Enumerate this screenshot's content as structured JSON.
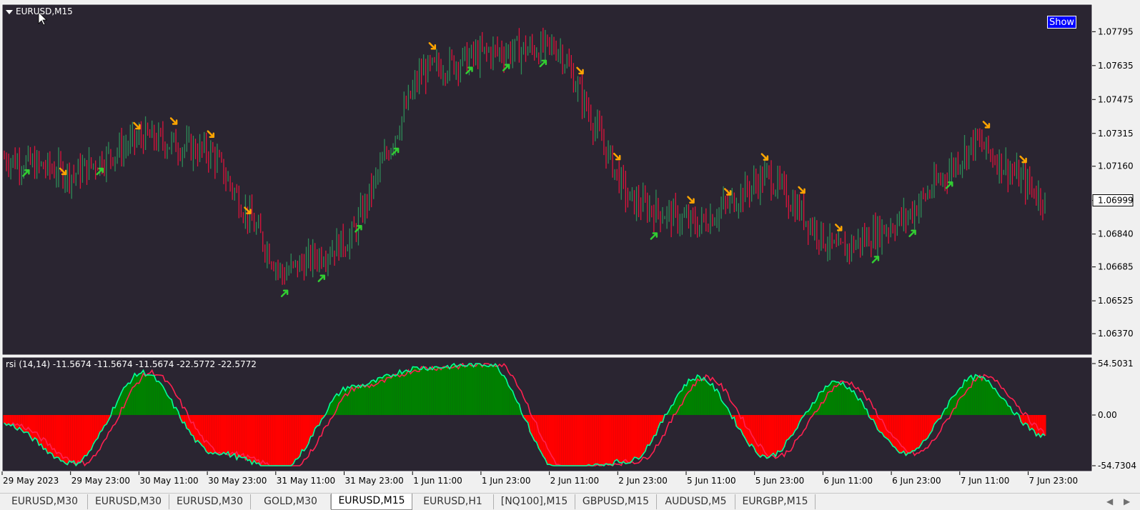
{
  "window": {
    "symbol_title": "EURUSD,M15",
    "show_button": "Show"
  },
  "colors": {
    "background": "#2a2531",
    "bull": "#2e8b57",
    "bear": "#dc143c",
    "buy_arrow": "#32cd32",
    "sell_arrow": "#ffa500",
    "rsi_pos": "#008000",
    "rsi_neg": "#ff0000",
    "rsi_fast": "#00ff99",
    "rsi_slow": "#ff2050"
  },
  "price_axis": {
    "labels": [
      "1.07795",
      "1.07635",
      "1.07475",
      "1.07315",
      "1.07160",
      "1.06999",
      "1.06840",
      "1.06685",
      "1.06525",
      "1.06370"
    ],
    "current_price": "1.06999"
  },
  "rsi_panel": {
    "label": "rsi  (14,14) -11.5674 -11.5674 -11.5674 -22.5772 -22.5772",
    "axis_labels": [
      "54.5031",
      "0.00",
      "-54.7304"
    ]
  },
  "time_axis": {
    "labels": [
      "29 May 2023",
      "29 May 23:00",
      "30 May 11:00",
      "30 May 23:00",
      "31 May 11:00",
      "31 May 23:00",
      "1 Jun 11:00",
      "1 Jun 23:00",
      "2 Jun 11:00",
      "2 Jun 23:00",
      "5 Jun 11:00",
      "5 Jun 23:00",
      "6 Jun 11:00",
      "6 Jun 23:00",
      "7 Jun 11:00",
      "7 Jun 23:00"
    ]
  },
  "tabs": [
    "EURUSD,M30",
    "EURUSD,M30",
    "EURUSD,M30",
    "GOLD,M30",
    "EURUSD,M15",
    "EURUSD,H1",
    "[NQ100],M15",
    "GBPUSD,M15",
    "AUDUSD,M5",
    "EURGBP,M15"
  ],
  "active_tab": "EURUSD,M15",
  "chart_data": {
    "type": "line",
    "title": "EURUSD,M15",
    "series": [
      {
        "name": "EURUSD,M15",
        "x": [
          "29 May 2023",
          "29 May 23:00",
          "30 May 11:00",
          "30 May 23:00",
          "31 May 11:00",
          "31 May 23:00",
          "1 Jun 11:00",
          "1 Jun 23:00",
          "2 Jun 11:00",
          "2 Jun 23:00",
          "5 Jun 11:00",
          "5 Jun 23:00",
          "6 Jun 11:00",
          "6 Jun 23:00",
          "7 Jun 11:00",
          "7 Jun 23:00"
        ],
        "values": [
          1.072,
          1.0712,
          1.073,
          1.0722,
          1.0665,
          1.0682,
          1.076,
          1.077,
          1.0772,
          1.07,
          1.0688,
          1.0712,
          1.0675,
          1.0692,
          1.0728,
          1.07
        ]
      }
    ],
    "ylim": [
      1.0633,
      1.0784
    ],
    "rsi": {
      "values": [
        -10,
        -52,
        45,
        -40,
        -58,
        30,
        50,
        54,
        -60,
        -50,
        40,
        -45,
        35,
        -42,
        40,
        -22.5772
      ],
      "ylim": [
        -54.7304,
        54.5031
      ]
    }
  }
}
